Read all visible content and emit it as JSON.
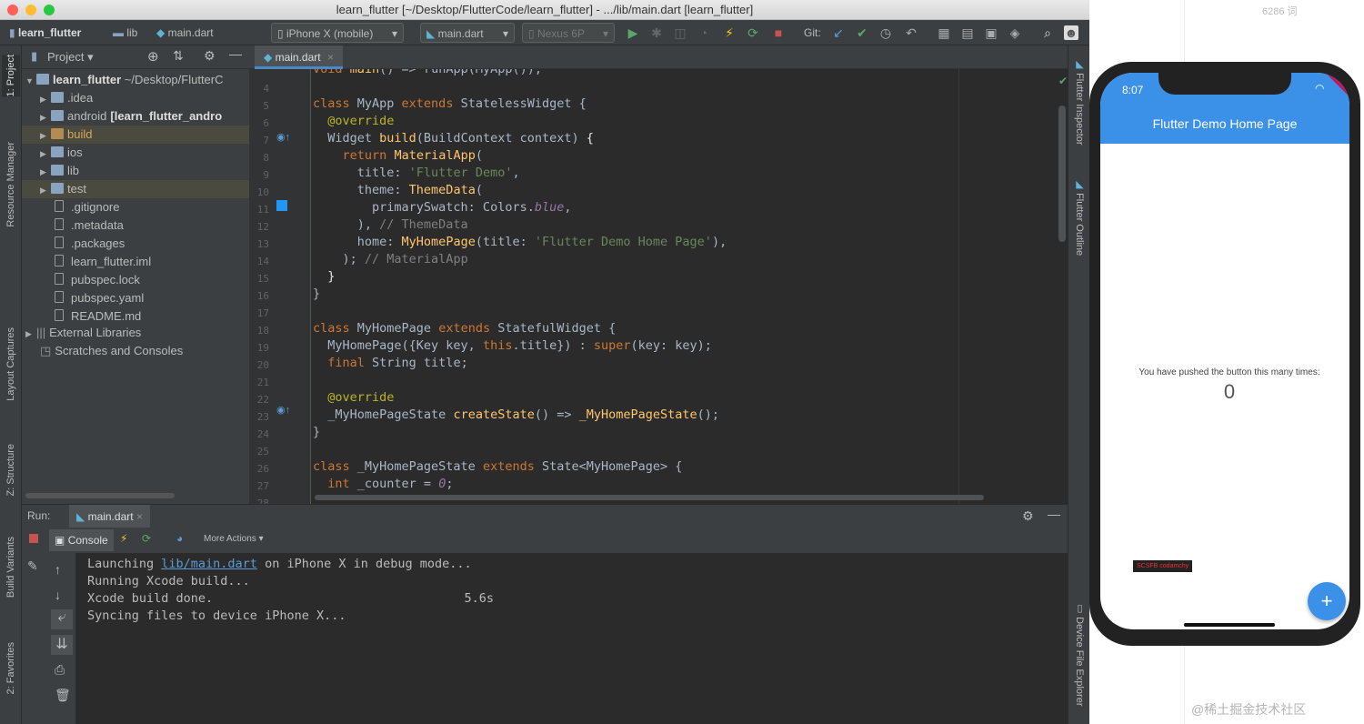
{
  "window": {
    "title": "learn_flutter [~/Desktop/FlutterCode/learn_flutter] - .../lib/main.dart [learn_flutter]"
  },
  "toolbar": {
    "breadcrumb": [
      "learn_flutter",
      "lib",
      "main.dart"
    ],
    "device_selector": "iPhone X (mobile)",
    "run_config": "main.dart",
    "emulator": "Nexus 6P",
    "git_label": "Git:"
  },
  "left_tabs": [
    "1: Project",
    "Resource Manager",
    "Layout Captures",
    "Z: Structure",
    "Build Variants",
    "2: Favorites"
  ],
  "right_tabs": [
    "Flutter Inspector",
    "Flutter Outline",
    "Device File Explorer"
  ],
  "project": {
    "header": "Project",
    "root": {
      "name": "learn_flutter",
      "path": "~/Desktop/FlutterC"
    },
    "items": [
      {
        "label": ".idea",
        "kind": "folder",
        "arrow": true,
        "excluded": false
      },
      {
        "label": "android",
        "bold_suffix": "[learn_flutter_andro",
        "kind": "folder",
        "arrow": true,
        "excluded": false
      },
      {
        "label": "build",
        "kind": "folder",
        "arrow": true,
        "excluded": true
      },
      {
        "label": "ios",
        "kind": "folder",
        "arrow": true,
        "excluded": false
      },
      {
        "label": "lib",
        "kind": "folder",
        "arrow": true,
        "excluded": false
      },
      {
        "label": "test",
        "kind": "folder",
        "arrow": true,
        "excluded": false
      },
      {
        "label": ".gitignore",
        "kind": "file",
        "arrow": false
      },
      {
        "label": ".metadata",
        "kind": "file",
        "arrow": false
      },
      {
        "label": ".packages",
        "kind": "file",
        "arrow": false
      },
      {
        "label": "learn_flutter.iml",
        "kind": "file",
        "arrow": false
      },
      {
        "label": "pubspec.lock",
        "kind": "file",
        "arrow": false
      },
      {
        "label": "pubspec.yaml",
        "kind": "file",
        "arrow": false
      },
      {
        "label": "README.md",
        "kind": "file",
        "arrow": false
      }
    ],
    "external": "External Libraries",
    "scratches": "Scratches and Consoles"
  },
  "editor": {
    "tab": "main.dart",
    "lines": [
      {
        "n": "",
        "html": "<span class='kw'>void</span> <span class='fn'>main</span>() => runApp(MyApp());"
      },
      {
        "n": "4",
        "html": ""
      },
      {
        "n": "5",
        "html": "<span class='kw'>class</span> MyApp <span class='kw'>extends</span> StatelessWidget {"
      },
      {
        "n": "6",
        "html": "  <span class='an'>@override</span>"
      },
      {
        "n": "7",
        "html": "  Widget <span class='fn'>build</span>(BuildContext context) <span class='br'>{</span>"
      },
      {
        "n": "8",
        "html": "    <span class='kw'>return</span> <span class='fn'>MaterialApp</span>("
      },
      {
        "n": "9",
        "html": "      title: <span class='st'>'Flutter Demo'</span>,"
      },
      {
        "n": "10",
        "html": "      theme: <span class='fn'>ThemeData</span>("
      },
      {
        "n": "11",
        "html": "        primarySwatch: Colors.<span class='it'>blue</span>,"
      },
      {
        "n": "12",
        "html": "      ), <span class='cm'>// ThemeData</span>"
      },
      {
        "n": "13",
        "html": "      home: <span class='fn'>MyHomePage</span>(title: <span class='st'>'Flutter Demo Home Page'</span>),"
      },
      {
        "n": "14",
        "html": "    ); <span class='cm'>// MaterialApp</span>"
      },
      {
        "n": "15",
        "html": "  <span class='br'>}</span>"
      },
      {
        "n": "16",
        "html": "}"
      },
      {
        "n": "17",
        "html": ""
      },
      {
        "n": "18",
        "html": "<span class='kw'>class</span> MyHomePage <span class='kw'>extends</span> StatefulWidget {"
      },
      {
        "n": "19",
        "html": "  MyHomePage({Key key, <span class='kw'>this</span>.title}) : <span class='kw'>super</span>(key: key);"
      },
      {
        "n": "20",
        "html": "  <span class='kw'>final</span> String title;"
      },
      {
        "n": "21",
        "html": ""
      },
      {
        "n": "22",
        "html": "  <span class='an'>@override</span>"
      },
      {
        "n": "23",
        "html": "  _MyHomePageState <span class='fn'>createState</span>() => <span class='fn'>_MyHomePageState</span>();"
      },
      {
        "n": "24",
        "html": "}"
      },
      {
        "n": "25",
        "html": ""
      },
      {
        "n": "26",
        "html": "<span class='kw'>class</span> _MyHomePageState <span class='kw'>extends</span> State&lt;MyHomePage&gt; {"
      },
      {
        "n": "27",
        "html": "  <span class='kw'>int</span> _counter = <span class='it'>0</span>;"
      },
      {
        "n": "28",
        "html": ""
      }
    ]
  },
  "run": {
    "label": "Run:",
    "tab": "main.dart",
    "console_tab": "Console",
    "more_actions": "More Actions",
    "output": [
      {
        "pre": "Launching ",
        "link": "lib/main.dart",
        "post": " on iPhone X in debug mode..."
      },
      {
        "pre": "Running Xcode build...",
        "link": "",
        "post": ""
      },
      {
        "pre": "Xcode build done.                                  5.6s",
        "link": "",
        "post": ""
      },
      {
        "pre": "Syncing files to device iPhone X...",
        "link": "",
        "post": ""
      }
    ]
  },
  "simulator": {
    "top_counter": "6286 词",
    "status_time": "8:07",
    "debug_banner": "DEBUG",
    "app_title": "Flutter Demo Home Page",
    "message": "You have pushed the button this many times:",
    "counter": "0",
    "fab": "+",
    "overlay_badge": "SCSFB codamchy"
  },
  "watermark": "@稀土掘金技术社区",
  "colors": {
    "accent": "#3b90e8",
    "ide_bg": "#2b2b2b",
    "panel_bg": "#3c3f41"
  }
}
